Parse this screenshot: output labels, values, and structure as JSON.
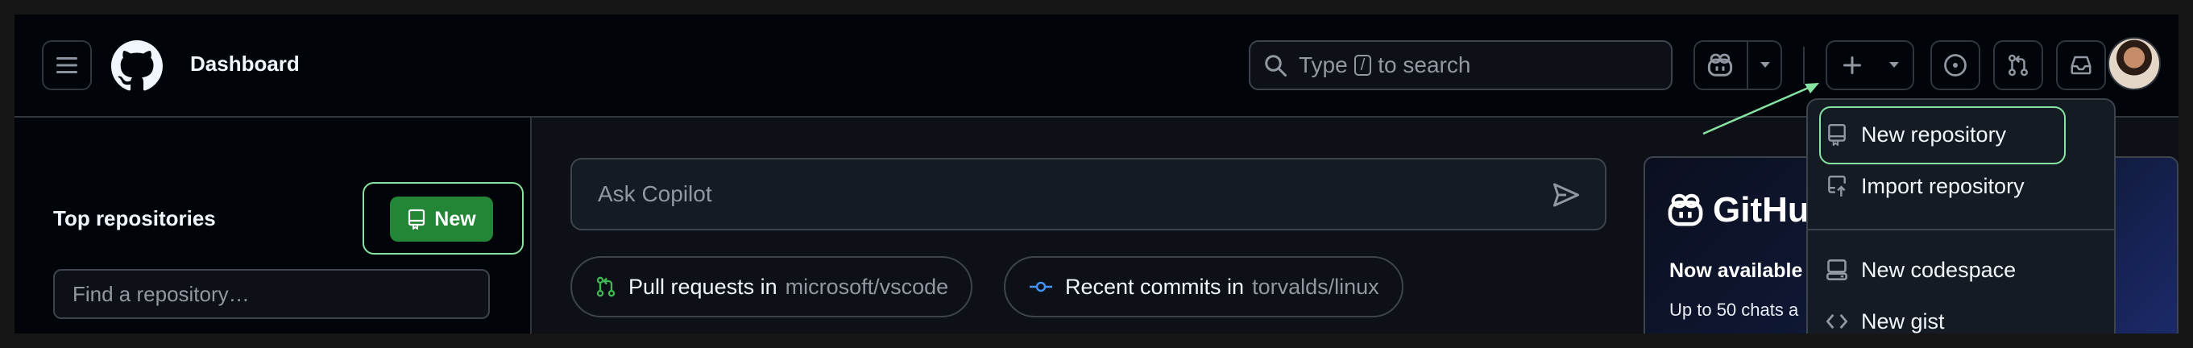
{
  "header": {
    "title": "Dashboard",
    "search_prefix": "Type",
    "search_key": "/",
    "search_suffix": "to search"
  },
  "sidebar": {
    "heading": "Top repositories",
    "new_button": "New",
    "find_placeholder": "Find a repository…"
  },
  "main": {
    "copilot_placeholder": "Ask Copilot",
    "suggestions": [
      {
        "label": "Pull requests in",
        "repo": "microsoft/vscode",
        "icon": "git-pull-request-icon"
      },
      {
        "label": "Recent commits in",
        "repo": "torvalds/linux",
        "icon": "git-commit-icon"
      }
    ]
  },
  "promo": {
    "brand": "GitHu",
    "headline": "Now available",
    "subtext": "Up to 50 chats a"
  },
  "create_menu": {
    "items": [
      {
        "label": "New repository",
        "icon": "repo-icon"
      },
      {
        "label": "Import repository",
        "icon": "repo-push-icon"
      },
      {
        "label": "New codespace",
        "icon": "codespaces-icon"
      },
      {
        "label": "New gist",
        "icon": "code-icon"
      }
    ]
  },
  "colors": {
    "accent_green": "#238636",
    "highlight_outline": "#86e3a1",
    "background": "#0d1117",
    "header_background": "#010409"
  }
}
